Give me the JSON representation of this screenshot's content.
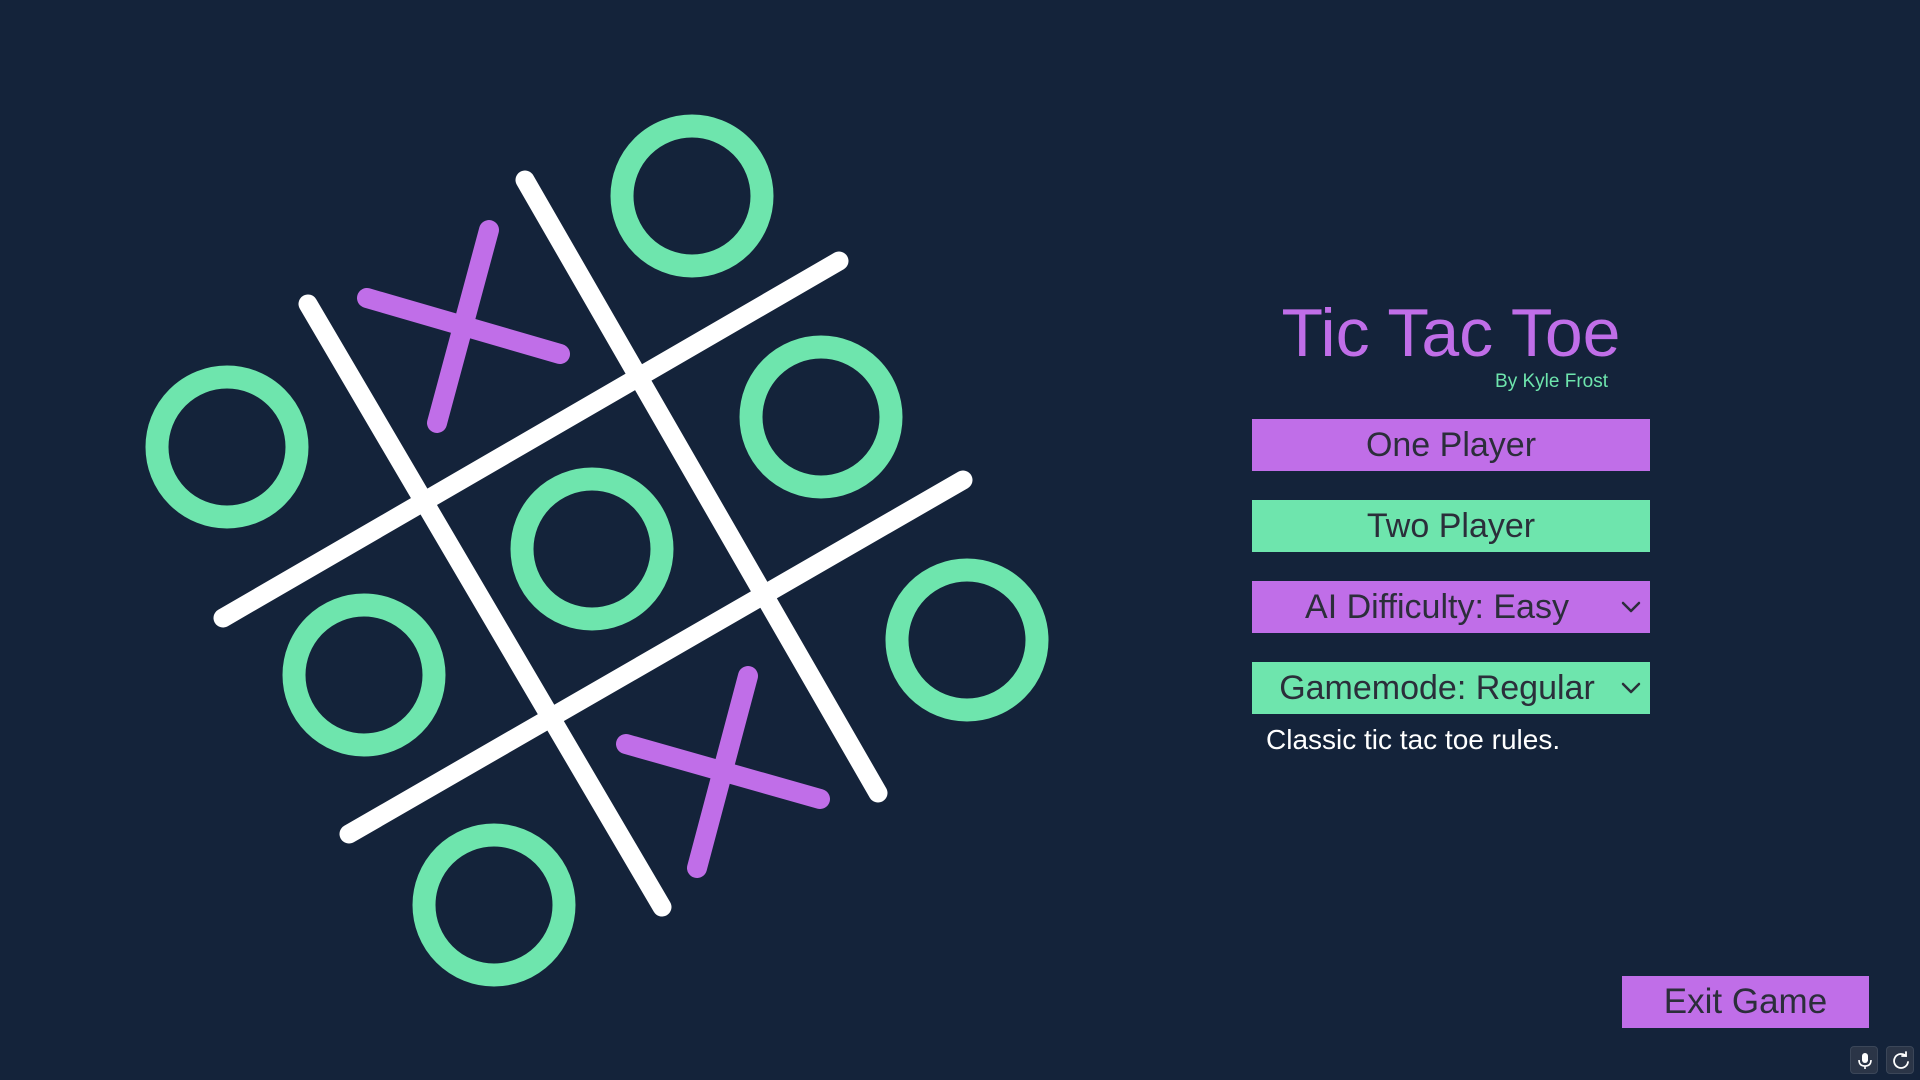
{
  "game": {
    "title": "Tic Tac Toe",
    "author": "By Kyle Frost",
    "board_marks": [
      "X",
      "O",
      "O",
      "O",
      "O",
      "O",
      "O",
      "X",
      "O"
    ]
  },
  "menu": {
    "one_player_label": "One Player",
    "two_player_label": "Two Player",
    "ai_difficulty": {
      "selected": "AI Difficulty: Easy"
    },
    "gamemode": {
      "selected": "Gamemode: Regular",
      "description": "Classic tic tac toe rules."
    },
    "exit_label": "Exit Game"
  },
  "icons": {
    "dropdown": "chevron-down-icon",
    "corner_left": "microphone-icon",
    "corner_right": "refresh-icon"
  },
  "colors": {
    "background": "#14233a",
    "accent_purple": "#c06ee8",
    "accent_green": "#6ee5ad",
    "grid": "#ffffff",
    "button_text": "#2b2e3a"
  }
}
